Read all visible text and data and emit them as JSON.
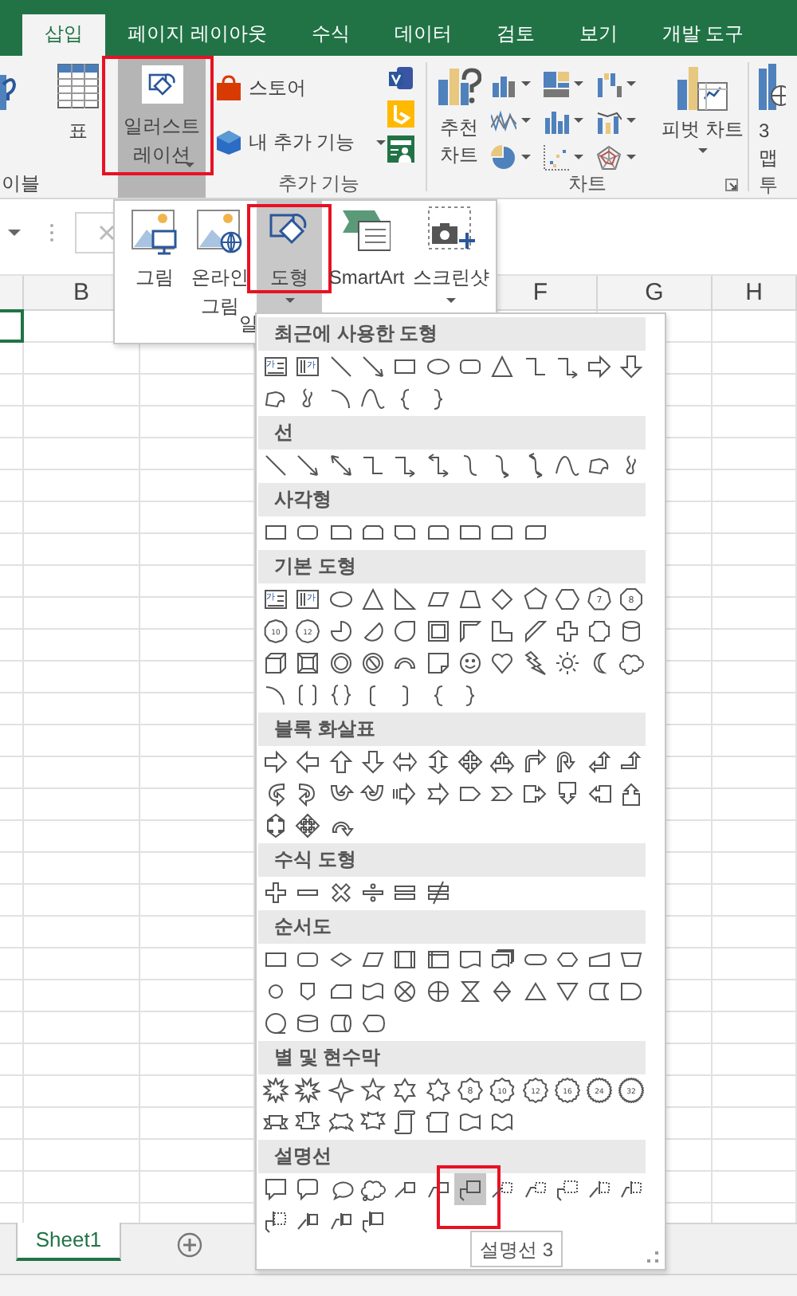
{
  "tabs": [
    {
      "label": "삽입",
      "selected": true
    },
    {
      "label": "페이지 레이아웃",
      "selected": false
    },
    {
      "label": "수식",
      "selected": false
    },
    {
      "label": "데이터",
      "selected": false
    },
    {
      "label": "검토",
      "selected": false
    },
    {
      "label": "보기",
      "selected": false
    },
    {
      "label": "개발 도구",
      "selected": false
    }
  ],
  "ribbon": {
    "pivot_table_label": "이블",
    "table_label": "표",
    "illustrations": {
      "label": "일러스트\n레이션",
      "pressed": true,
      "annotated": true
    },
    "addins": {
      "store": "스토어",
      "my_addins": "내 추가 기능",
      "group_label": "추가 기능"
    },
    "charts": {
      "recommended": "추천\n차트",
      "pivot_chart": "피벗 차트",
      "group_label": "차트"
    },
    "map_label": "3\n맵",
    "tours_group_label": "투"
  },
  "illustrations_menu": {
    "items": [
      {
        "kind": "picture",
        "label": "그림",
        "selected": false,
        "annotated": false,
        "has_menu": false
      },
      {
        "kind": "online_picture",
        "label": "온라인\n그림",
        "selected": false,
        "annotated": false,
        "has_menu": false
      },
      {
        "kind": "shapes",
        "label": "도형",
        "selected": true,
        "annotated": true,
        "has_menu": true
      },
      {
        "kind": "smartart",
        "label": "SmartArt",
        "selected": false,
        "annotated": false,
        "has_menu": false
      },
      {
        "kind": "screenshot",
        "label": "스크린샷",
        "selected": false,
        "annotated": false,
        "has_menu": true
      }
    ],
    "group_label": "일"
  },
  "column_headers": [
    {
      "label": "B"
    },
    {
      "label": "F"
    },
    {
      "label": "G"
    },
    {
      "label": "H"
    }
  ],
  "shape_gallery": {
    "sections": [
      {
        "title": "최근에 사용한 도형",
        "shapes": [
          {
            "kind": "textbox",
            "text": "가",
            "selected": false
          },
          {
            "kind": "textbox_vertical",
            "text": "가",
            "selected": false
          },
          {
            "kind": "line",
            "selected": false
          },
          {
            "kind": "arrow_line",
            "selected": false
          },
          {
            "kind": "rect",
            "selected": false
          },
          {
            "kind": "ellipse",
            "selected": false
          },
          {
            "kind": "rounded_rect",
            "selected": false
          },
          {
            "kind": "triangle",
            "selected": false
          },
          {
            "kind": "elbow_connector",
            "selected": false
          },
          {
            "kind": "elbow_arrow",
            "selected": false
          },
          {
            "kind": "right_arrow",
            "selected": false
          },
          {
            "kind": "down_arrow",
            "selected": false
          },
          {
            "kind": "freeform",
            "selected": false
          },
          {
            "kind": "scribble",
            "selected": false
          },
          {
            "kind": "arc",
            "selected": false
          },
          {
            "kind": "curve",
            "selected": false
          },
          {
            "kind": "left_brace",
            "selected": false
          },
          {
            "kind": "right_brace",
            "selected": false
          }
        ]
      },
      {
        "title": "선",
        "shapes": [
          {
            "kind": "line",
            "selected": false
          },
          {
            "kind": "arrow_line",
            "selected": false
          },
          {
            "kind": "double_arrow_line",
            "selected": false
          },
          {
            "kind": "elbow_connector",
            "selected": false
          },
          {
            "kind": "elbow_arrow",
            "selected": false
          },
          {
            "kind": "elbow_double_arrow",
            "selected": false
          },
          {
            "kind": "curved_connector",
            "selected": false
          },
          {
            "kind": "curved_arrow",
            "selected": false
          },
          {
            "kind": "curved_double_arrow",
            "selected": false
          },
          {
            "kind": "curve",
            "selected": false
          },
          {
            "kind": "freeform",
            "selected": false
          },
          {
            "kind": "scribble",
            "selected": false
          }
        ]
      },
      {
        "title": "사각형",
        "shapes": [
          {
            "kind": "rect",
            "selected": false
          },
          {
            "kind": "rounded_rect",
            "selected": false
          },
          {
            "kind": "snip_single",
            "selected": false
          },
          {
            "kind": "snip_same",
            "selected": false
          },
          {
            "kind": "snip_diagonal",
            "selected": false
          },
          {
            "kind": "snip_round",
            "selected": false
          },
          {
            "kind": "round_single",
            "selected": false
          },
          {
            "kind": "round_same",
            "selected": false
          },
          {
            "kind": "round_diagonal",
            "selected": false
          }
        ]
      },
      {
        "title": "기본 도형",
        "shapes": [
          {
            "kind": "textbox",
            "text": "가",
            "selected": false
          },
          {
            "kind": "textbox_vertical",
            "text": "가",
            "selected": false
          },
          {
            "kind": "ellipse",
            "selected": false
          },
          {
            "kind": "triangle",
            "selected": false
          },
          {
            "kind": "right_triangle",
            "selected": false
          },
          {
            "kind": "parallelogram",
            "selected": false
          },
          {
            "kind": "trapezoid",
            "selected": false
          },
          {
            "kind": "diamond",
            "selected": false
          },
          {
            "kind": "pentagon",
            "selected": false
          },
          {
            "kind": "hexagon",
            "selected": false
          },
          {
            "kind": "heptagon",
            "text": "7",
            "selected": false
          },
          {
            "kind": "octagon",
            "text": "8",
            "selected": false
          },
          {
            "kind": "decagon",
            "text": "10",
            "selected": false
          },
          {
            "kind": "dodecagon",
            "text": "12",
            "selected": false
          },
          {
            "kind": "pie",
            "selected": false
          },
          {
            "kind": "chord",
            "selected": false
          },
          {
            "kind": "teardrop",
            "selected": false
          },
          {
            "kind": "frame",
            "selected": false
          },
          {
            "kind": "half_frame",
            "selected": false
          },
          {
            "kind": "l_shape",
            "selected": false
          },
          {
            "kind": "diagonal_stripe",
            "selected": false
          },
          {
            "kind": "cross",
            "selected": false
          },
          {
            "kind": "plaque",
            "selected": false
          },
          {
            "kind": "can",
            "selected": false
          },
          {
            "kind": "cube",
            "selected": false
          },
          {
            "kind": "bevel",
            "selected": false
          },
          {
            "kind": "donut",
            "selected": false
          },
          {
            "kind": "no_symbol",
            "selected": false
          },
          {
            "kind": "block_arc",
            "selected": false
          },
          {
            "kind": "folded_corner",
            "selected": false
          },
          {
            "kind": "smiley",
            "selected": false
          },
          {
            "kind": "heart",
            "selected": false
          },
          {
            "kind": "lightning",
            "selected": false
          },
          {
            "kind": "sun",
            "selected": false
          },
          {
            "kind": "moon",
            "selected": false
          },
          {
            "kind": "cloud",
            "selected": false
          },
          {
            "kind": "arc",
            "selected": false
          },
          {
            "kind": "bracket_pair",
            "selected": false
          },
          {
            "kind": "brace_pair",
            "selected": false
          },
          {
            "kind": "left_bracket",
            "selected": false
          },
          {
            "kind": "right_bracket",
            "selected": false
          },
          {
            "kind": "left_brace",
            "selected": false
          },
          {
            "kind": "right_brace",
            "selected": false
          }
        ]
      },
      {
        "title": "블록 화살표",
        "shapes": [
          {
            "kind": "right_arrow",
            "selected": false
          },
          {
            "kind": "left_arrow",
            "selected": false
          },
          {
            "kind": "up_arrow",
            "selected": false
          },
          {
            "kind": "down_arrow",
            "selected": false
          },
          {
            "kind": "left_right_arrow",
            "selected": false
          },
          {
            "kind": "up_down_arrow",
            "selected": false
          },
          {
            "kind": "quad_arrow",
            "selected": false
          },
          {
            "kind": "left_right_up_arrow",
            "selected": false
          },
          {
            "kind": "bent_arrow",
            "selected": false
          },
          {
            "kind": "u_turn_arrow",
            "selected": false
          },
          {
            "kind": "left_up_arrow",
            "selected": false
          },
          {
            "kind": "bent_up_arrow",
            "selected": false
          },
          {
            "kind": "curved_right_arrow",
            "selected": false
          },
          {
            "kind": "curved_left_arrow",
            "selected": false
          },
          {
            "kind": "curved_up_arrow",
            "selected": false
          },
          {
            "kind": "curved_down_arrow",
            "selected": false
          },
          {
            "kind": "striped_right_arrow",
            "selected": false
          },
          {
            "kind": "notched_right_arrow",
            "selected": false
          },
          {
            "kind": "pentagon_arrow",
            "selected": false
          },
          {
            "kind": "chevron",
            "selected": false
          },
          {
            "kind": "right_arrow_callout",
            "selected": false
          },
          {
            "kind": "down_arrow_callout",
            "selected": false
          },
          {
            "kind": "left_arrow_callout",
            "selected": false
          },
          {
            "kind": "up_arrow_callout",
            "selected": false
          },
          {
            "kind": "up_down_arrow_callout",
            "selected": false
          },
          {
            "kind": "quad_arrow_callout",
            "selected": false
          },
          {
            "kind": "circular_arrow",
            "selected": false
          }
        ]
      },
      {
        "title": "수식 도형",
        "shapes": [
          {
            "kind": "plus",
            "selected": false
          },
          {
            "kind": "minus",
            "selected": false
          },
          {
            "kind": "multiply",
            "selected": false
          },
          {
            "kind": "divide",
            "selected": false
          },
          {
            "kind": "equal",
            "selected": false
          },
          {
            "kind": "not_equal",
            "selected": false
          }
        ]
      },
      {
        "title": "순서도",
        "shapes": [
          {
            "kind": "process",
            "selected": false
          },
          {
            "kind": "alternate_process",
            "selected": false
          },
          {
            "kind": "decision",
            "selected": false
          },
          {
            "kind": "data",
            "selected": false
          },
          {
            "kind": "predefined_process",
            "selected": false
          },
          {
            "kind": "internal_storage",
            "selected": false
          },
          {
            "kind": "document",
            "selected": false
          },
          {
            "kind": "multidocument",
            "selected": false
          },
          {
            "kind": "terminator",
            "selected": false
          },
          {
            "kind": "preparation",
            "selected": false
          },
          {
            "kind": "manual_input",
            "selected": false
          },
          {
            "kind": "manual_operation",
            "selected": false
          },
          {
            "kind": "connector",
            "selected": false
          },
          {
            "kind": "offpage_connector",
            "selected": false
          },
          {
            "kind": "card",
            "selected": false
          },
          {
            "kind": "punched_tape",
            "selected": false
          },
          {
            "kind": "summing_junction",
            "selected": false
          },
          {
            "kind": "or",
            "selected": false
          },
          {
            "kind": "collate",
            "selected": false
          },
          {
            "kind": "sort",
            "selected": false
          },
          {
            "kind": "extract",
            "selected": false
          },
          {
            "kind": "merge",
            "selected": false
          },
          {
            "kind": "stored_data",
            "selected": false
          },
          {
            "kind": "delay",
            "selected": false
          },
          {
            "kind": "sequential_storage",
            "selected": false
          },
          {
            "kind": "magnetic_disk",
            "selected": false
          },
          {
            "kind": "direct_access_storage",
            "selected": false
          },
          {
            "kind": "display",
            "selected": false
          }
        ]
      },
      {
        "title": "별 및 현수막",
        "shapes": [
          {
            "kind": "explosion_1",
            "selected": false
          },
          {
            "kind": "explosion_2",
            "selected": false
          },
          {
            "kind": "star_4",
            "selected": false
          },
          {
            "kind": "star_5",
            "selected": false
          },
          {
            "kind": "star_6",
            "selected": false
          },
          {
            "kind": "star_7",
            "selected": false
          },
          {
            "kind": "star_8",
            "text": "8",
            "selected": false
          },
          {
            "kind": "star_10",
            "text": "10",
            "selected": false
          },
          {
            "kind": "star_12",
            "text": "12",
            "selected": false
          },
          {
            "kind": "star_16",
            "text": "16",
            "selected": false
          },
          {
            "kind": "star_24",
            "text": "24",
            "selected": false
          },
          {
            "kind": "star_32",
            "text": "32",
            "selected": false
          },
          {
            "kind": "ribbon_up",
            "selected": false
          },
          {
            "kind": "ribbon_down",
            "selected": false
          },
          {
            "kind": "curved_ribbon_up",
            "selected": false
          },
          {
            "kind": "curved_ribbon_down",
            "selected": false
          },
          {
            "kind": "vertical_scroll",
            "selected": false
          },
          {
            "kind": "horizontal_scroll",
            "selected": false
          },
          {
            "kind": "wave",
            "selected": false
          },
          {
            "kind": "double_wave",
            "selected": false
          }
        ]
      },
      {
        "title": "설명선",
        "shapes": [
          {
            "kind": "rect_callout",
            "selected": false
          },
          {
            "kind": "rounded_rect_callout",
            "selected": false
          },
          {
            "kind": "oval_callout",
            "selected": false
          },
          {
            "kind": "cloud_callout",
            "selected": false
          },
          {
            "kind": "line_callout_1",
            "selected": false
          },
          {
            "kind": "line_callout_2",
            "selected": false
          },
          {
            "kind": "line_callout_3",
            "selected": true,
            "annotated": true
          },
          {
            "kind": "line_callout_1_no_border",
            "selected": false
          },
          {
            "kind": "line_callout_2_no_border",
            "selected": false
          },
          {
            "kind": "line_callout_3_no_border",
            "selected": false
          },
          {
            "kind": "line_callout_1_accent_no_border",
            "selected": false
          },
          {
            "kind": "line_callout_2_accent_no_border",
            "selected": false
          },
          {
            "kind": "line_callout_3_accent_no_border",
            "selected": false
          },
          {
            "kind": "line_callout_1_accent",
            "selected": false
          },
          {
            "kind": "line_callout_2_accent",
            "selected": false
          },
          {
            "kind": "line_callout_3_accent",
            "selected": false
          }
        ]
      }
    ],
    "tooltip": "설명선 3"
  },
  "sheets": [
    {
      "label": "Sheet1",
      "selected": true
    }
  ]
}
